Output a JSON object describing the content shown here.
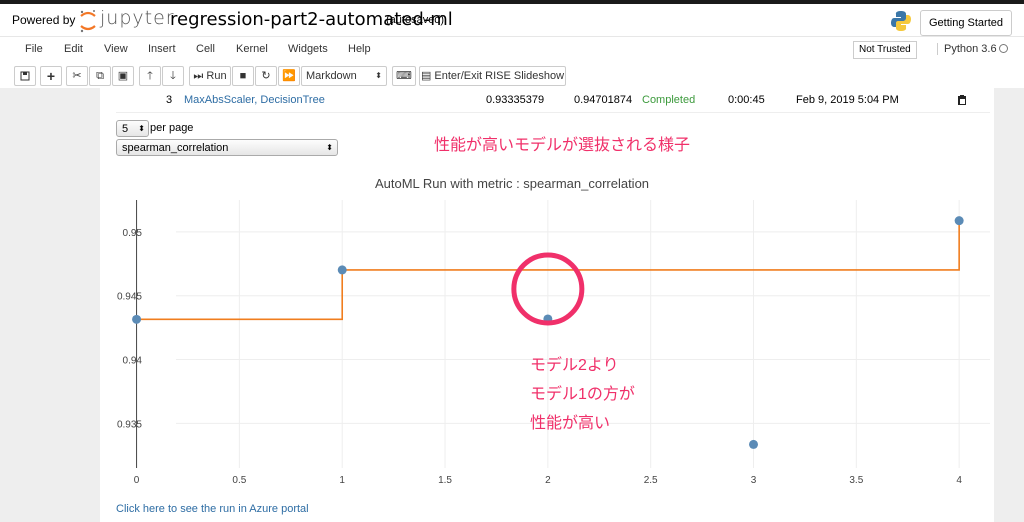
{
  "header": {
    "powered_by": "Powered by",
    "jupyter": "jupyter",
    "notebook_name": "regression-part2-automated-ml",
    "autosaved": "(autosaved)",
    "getting_started": "Getting Started"
  },
  "menu": {
    "items": [
      "File",
      "Edit",
      "View",
      "Insert",
      "Cell",
      "Kernel",
      "Widgets",
      "Help"
    ],
    "trusted": "Not Trusted",
    "kernel": "Python 3.6"
  },
  "toolbar": {
    "run_label": "Run",
    "cell_type": "Markdown",
    "rise": "Enter/Exit RISE Slideshow"
  },
  "table_row": {
    "index": "3",
    "pipeline": "MaxAbsScaler, DecisionTree",
    "score1": "0.93335379",
    "score2": "0.94701874",
    "status": "Completed",
    "duration": "0:00:45",
    "timestamp": "Feb 9, 2019 5:04 PM"
  },
  "controls": {
    "per_page_value": "5",
    "per_page_label": "per page",
    "metric": "spearman_correlation"
  },
  "annotations": {
    "top": "性能が高いモデルが選抜される様子",
    "line1": "モデル2より",
    "line2": "モデル1の方が",
    "line3": "性能が高い"
  },
  "colors": {
    "accent": "#f0306a",
    "point": "#5b8bb6",
    "line": "#f07d1e",
    "status": "#3c9a3c"
  },
  "chart_data": {
    "type": "scatter",
    "title": "AutoML Run with metric : spearman_correlation",
    "x": [
      0,
      1,
      2,
      3,
      4
    ],
    "y": [
      0.94315,
      0.94702,
      0.94318,
      0.93335,
      0.95088
    ],
    "best_so_far": [
      0.94315,
      0.94702,
      0.94702,
      0.94702,
      0.95088
    ],
    "xlim": [
      -0.1,
      4.15
    ],
    "ylim": [
      0.9315,
      0.9525
    ],
    "xticks": [
      "0",
      "0.5",
      "1",
      "1.5",
      "2",
      "2.5",
      "3",
      "3.5",
      "4"
    ],
    "xtick_values": [
      0,
      0.5,
      1,
      1.5,
      2,
      2.5,
      3,
      3.5,
      4
    ],
    "yticks": [
      "0.935",
      "0.94",
      "0.945",
      "0.95"
    ],
    "ytick_values": [
      0.935,
      0.94,
      0.945,
      0.95
    ],
    "grid": true,
    "highlight_x": 2
  },
  "footer": {
    "link": "Click here to see the run in Azure portal"
  }
}
